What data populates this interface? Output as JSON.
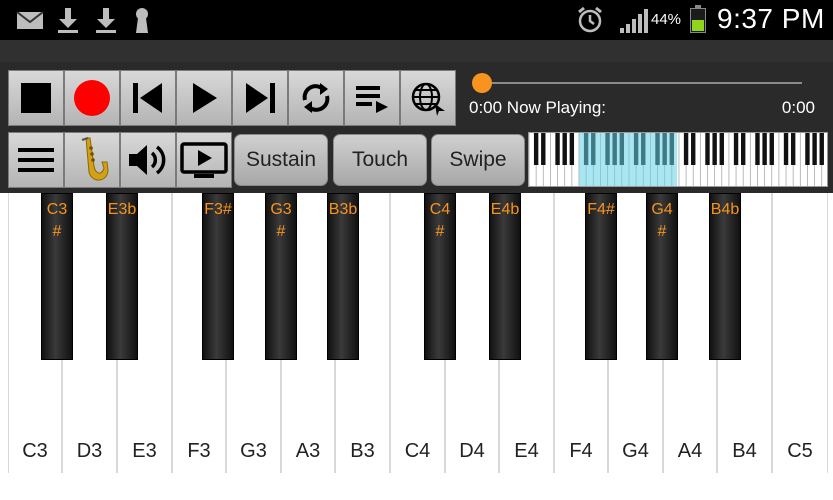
{
  "status_bar": {
    "icons": [
      "mail-icon",
      "download-icon",
      "download-icon",
      "keyhole-icon",
      "alarm-icon",
      "signal-icon",
      "battery-icon"
    ],
    "battery_percent": "44%",
    "time": "9:37 PM"
  },
  "transport": {
    "buttons": [
      "stop",
      "record",
      "skip-previous",
      "play",
      "skip-next",
      "loop",
      "playlist",
      "globe"
    ]
  },
  "player": {
    "now_playing": "0:00 Now Playing:",
    "end_time": "0:00",
    "progress": 0.0
  },
  "controls": {
    "sustain_label": "Sustain",
    "touch_label": "Touch",
    "swipe_label": "Swipe"
  },
  "keyboard": {
    "white_keys": [
      "C3",
      "D3",
      "E3",
      "F3",
      "G3",
      "A3",
      "B3",
      "C4",
      "D4",
      "E4",
      "F4",
      "G4",
      "A4",
      "B4",
      "C5"
    ],
    "black_keys": [
      "C3\n#",
      "E3b",
      "F3#",
      "G3\n#",
      "B3b",
      "C4\n#",
      "E4b",
      "F4#",
      "G4\n#",
      "B4b"
    ]
  },
  "colors": {
    "accent": "#f7931e",
    "record": "#ff0000",
    "highlight": "#64d2e6"
  }
}
